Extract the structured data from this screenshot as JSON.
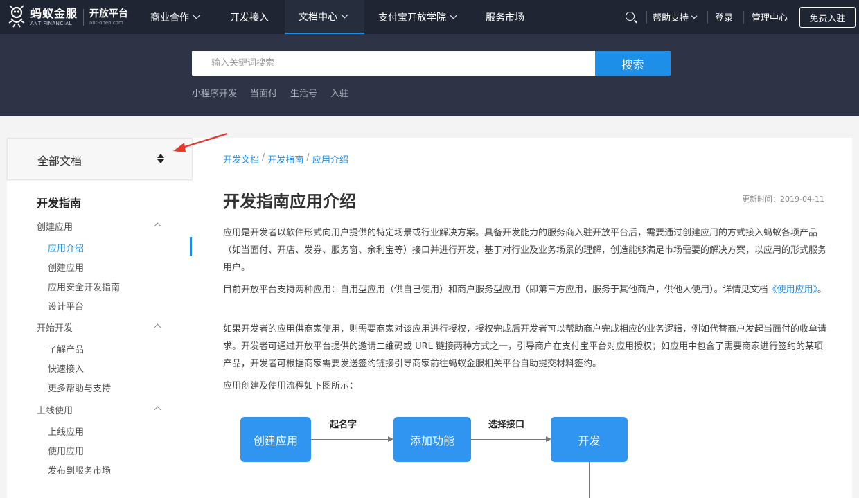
{
  "brand": {
    "name_cn": "蚂蚁金服",
    "name_en": "ANT FINANCIAL",
    "platform_cn": "开放平台",
    "platform_en": "ant-open.com"
  },
  "topnav": {
    "items": [
      {
        "label": "商业合作",
        "dropdown": true
      },
      {
        "label": "开发接入",
        "dropdown": false
      },
      {
        "label": "文档中心",
        "dropdown": true,
        "active": true
      },
      {
        "label": "支付宝开放学院",
        "dropdown": true
      },
      {
        "label": "服务市场",
        "dropdown": false
      }
    ],
    "help": "帮助支持",
    "login": "登录",
    "admin": "管理中心",
    "signup": "免费入驻"
  },
  "search": {
    "placeholder": "输入关键词搜索",
    "button": "搜索",
    "hot_links": [
      "小程序开发",
      "当面付",
      "生活号",
      "入驻"
    ]
  },
  "sidebar": {
    "header": "全部文档",
    "section": "开发指南",
    "groups": [
      {
        "label": "创建应用",
        "items": [
          "应用介绍",
          "创建应用",
          "应用安全开发指南",
          "设计平台"
        ]
      },
      {
        "label": "开始开发",
        "items": [
          "了解产品",
          "快速接入",
          "更多帮助与支持"
        ]
      },
      {
        "label": "上线使用",
        "items": [
          "上线应用",
          "使用应用",
          "发布到服务市场"
        ]
      }
    ]
  },
  "main": {
    "breadcrumb": [
      "开发文档",
      "开发指南",
      "应用介绍"
    ],
    "title": "开发指南应用介绍",
    "update_time": "更新时间：2019-04-11",
    "p1": "应用是开发者以软件形式向用户提供的特定场景或行业解决方案。具备开发能力的服务商入驻开放平台后，需要通过创建应用的方式接入蚂蚁各项产品（如当面付、开店、发券、服务窗、余利宝等）接口并进行开发，基于对行业及业务场景的理解，创造能够满足市场需要的解决方案，以应用的形式服务用户。",
    "p2_before": "目前开放平台支持两种应用：自用型应用（供自己使用）和商户服务型应用（即第三方应用，服务于其他商户，供他人使用）。详情见文档",
    "p2_link": "《使用应用》",
    "p2_after": "。",
    "p3": "如果开发者的应用供商家使用，则需要商家对该应用进行授权，授权完成后开发者可以帮助商户完成相应的业务逻辑，例如代替商户发起当面付的收单请求。开发者可通过开放平台提供的邀请二维码或 URL 链接两种方式之一，引导商户在支付宝平台对应用授权；如应用中包含了需要商家进行签约的某项产品，开发者可根据商家需要发送签约链接引导商家前往蚂蚁金服相关平台自助提交材料签约。",
    "p4": "应用创建及使用流程如下图所示：",
    "flow": {
      "steps": [
        "创建应用",
        "添加功能",
        "开发"
      ],
      "labels": [
        "起名字",
        "选择接口"
      ]
    }
  },
  "colors": {
    "nav_bg": "#1f2533",
    "hero_bg": "#2e3446",
    "accent": "#1e8fe8",
    "flow_box": "#2f95f0",
    "annotation": "#e8392f"
  }
}
